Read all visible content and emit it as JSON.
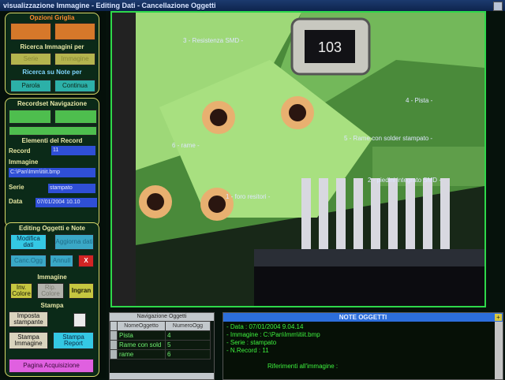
{
  "window": {
    "title": "visualizzazione Immagine - Editing Dati - Cancellazione Oggetti"
  },
  "opzioni_griglia": {
    "title": "Opzioni Griglia",
    "ricerca_immagini_title": "Ricerca Immagini per",
    "btn_serie": "Serie",
    "btn_immagine": "Immagine",
    "ricerca_note_title": "Ricerca su Note per",
    "btn_parola": "Parola",
    "btn_continua": "Continua"
  },
  "recordset": {
    "title": "Recordset Navigazione",
    "elementi_title": "Elementi del Record",
    "record_label": "Record",
    "record_value": "11",
    "immagine_label": "Immagine",
    "immagine_value": "C:\\Pan\\Imm\\itiit.bmp",
    "serie_label": "Serie",
    "serie_value": "stampato",
    "data_label": "Data",
    "data_value": "07/01/2004 10.10"
  },
  "editing": {
    "title": "Editing Oggetti e Note",
    "btn_modifica": "Modifica dati",
    "btn_aggiorna": "Aggiorna dati",
    "btn_cancogg": "Canc.Ogg",
    "btn_annull": "Annull",
    "btn_close": "X",
    "immagine_title": "Immagine",
    "btn_inv": "Inv. Colore",
    "btn_rip": "Rip. Colore",
    "btn_ingran": "Ingran",
    "stampa_title": "Stampa",
    "btn_imposta": "Imposta stampante",
    "btn_stampa_img": "Stampa Immagine",
    "btn_stampa_rep": "Stampa Report",
    "btn_acquisizione": "Pagina Acquisizione"
  },
  "image_labels": [
    "3 - Resistenza SMD -",
    "4 - Pista -",
    "6 - rame -",
    "5 - Rame con solder stampato -",
    "2 - piedini integrato SMD -",
    "1 - foro resitori -"
  ],
  "resistor_code": "103",
  "grid": {
    "title": "Navigazione Oggetti",
    "col1": "NomeOggetto",
    "col2": "NumeroOgg",
    "rows": [
      {
        "name": "Pista",
        "num": "4"
      },
      {
        "name": "Rame con sold",
        "num": "5"
      },
      {
        "name": "rame",
        "num": "6"
      }
    ]
  },
  "notes": {
    "title": "NOTE OGGETTI",
    "lines": [
      "- Data : 07/01/2004 9.04.14",
      "- Immagine : C:\\Pan\\Imm\\itiit.bmp",
      "- Serie : stampato",
      "- N.Record : 11",
      "",
      "Riferimenti all'immagine :"
    ]
  }
}
